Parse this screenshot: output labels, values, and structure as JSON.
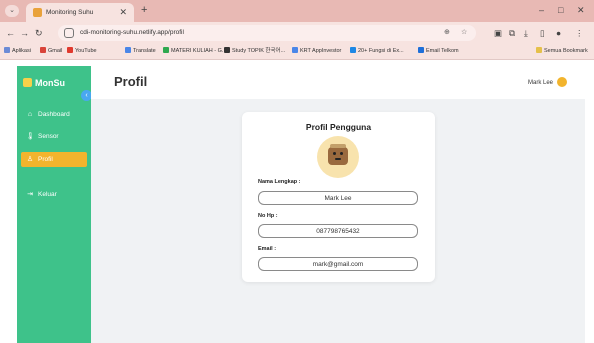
{
  "browser": {
    "tab_title": "Monitoring Suhu",
    "url": "cdi-monitoring-suhu.netlify.app/profil",
    "bookmarks": [
      "Aplikasi",
      "Gmail",
      "YouTube",
      "Translate",
      "MATERI KULIAH - G...",
      "Study TOPIK 한국어...",
      "KRT AppInvestor",
      "20+ Fungsi di Ex...",
      "Email Telkom"
    ],
    "all_bookmarks_label": "Semua Bookmark"
  },
  "sidebar": {
    "brand": "MonSu",
    "items": [
      {
        "label": "Dashboard",
        "icon": "home-icon",
        "active": false
      },
      {
        "label": "Sensor",
        "icon": "thermometer-icon",
        "active": false
      },
      {
        "label": "Profil",
        "icon": "user-icon",
        "active": true
      },
      {
        "label": "Keluar",
        "icon": "logout-icon",
        "active": false
      }
    ]
  },
  "header": {
    "title": "Profil",
    "user_name": "Mark Lee"
  },
  "profile_card": {
    "title": "Profil Pengguna",
    "fields": [
      {
        "label": "Nama Lengkap :",
        "value": "Mark Lee"
      },
      {
        "label": "No Hp :",
        "value": "087798765432"
      },
      {
        "label": "Email :",
        "value": "mark@gmail.com"
      }
    ]
  },
  "colors": {
    "sidebar": "#3ec28a",
    "active_item": "#f2b42d",
    "chrome": "#e8b9b4"
  }
}
